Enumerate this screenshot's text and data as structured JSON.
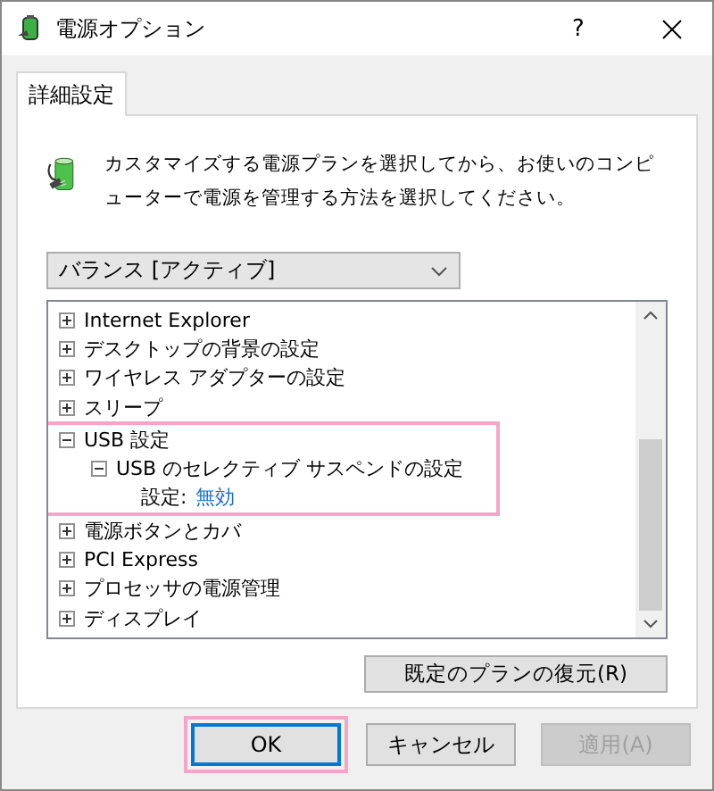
{
  "window": {
    "title": "電源オプション",
    "help": "?"
  },
  "tabs": [
    {
      "label": "詳細設定",
      "selected": true
    }
  ],
  "description": "カスタマイズする電源プランを選択してから、お使いのコンピューターで電源を管理する方法を選択してください。",
  "plan_dropdown": {
    "value": "バランス [アクティブ]"
  },
  "settings_tree": [
    {
      "kind": "group",
      "label": "Internet Explorer",
      "expanded": false,
      "highlighted": false
    },
    {
      "kind": "group",
      "label": "デスクトップの背景の設定",
      "expanded": false,
      "highlighted": false
    },
    {
      "kind": "group",
      "label": "ワイヤレス アダプターの設定",
      "expanded": false,
      "highlighted": false
    },
    {
      "kind": "group",
      "label": "スリープ",
      "expanded": false,
      "highlighted": false
    },
    {
      "kind": "group",
      "label": "USB 設定",
      "expanded": true,
      "highlighted": true,
      "children": [
        {
          "kind": "group",
          "label": "USB のセレクティブ サスペンドの設定",
          "expanded": true,
          "highlighted": false,
          "children": [
            {
              "kind": "value",
              "label": "設定:",
              "value": "無効"
            }
          ]
        }
      ]
    },
    {
      "kind": "group",
      "label": "電源ボタンとカバ",
      "expanded": false,
      "highlighted": false
    },
    {
      "kind": "group",
      "label": "PCI Express",
      "expanded": false,
      "highlighted": false
    },
    {
      "kind": "group",
      "label": "プロセッサの電源管理",
      "expanded": false,
      "highlighted": false
    },
    {
      "kind": "group",
      "label": "ディスプレイ",
      "expanded": false,
      "highlighted": false
    }
  ],
  "restore_button": {
    "label": "既定のプランの復元(R)"
  },
  "buttons": [
    {
      "label": "OK",
      "kind": "default",
      "disabled": false,
      "highlighted": true
    },
    {
      "label": "キャンセル",
      "kind": "normal",
      "disabled": false,
      "highlighted": false
    },
    {
      "label": "適用(A)",
      "kind": "normal",
      "disabled": true,
      "highlighted": false
    }
  ]
}
